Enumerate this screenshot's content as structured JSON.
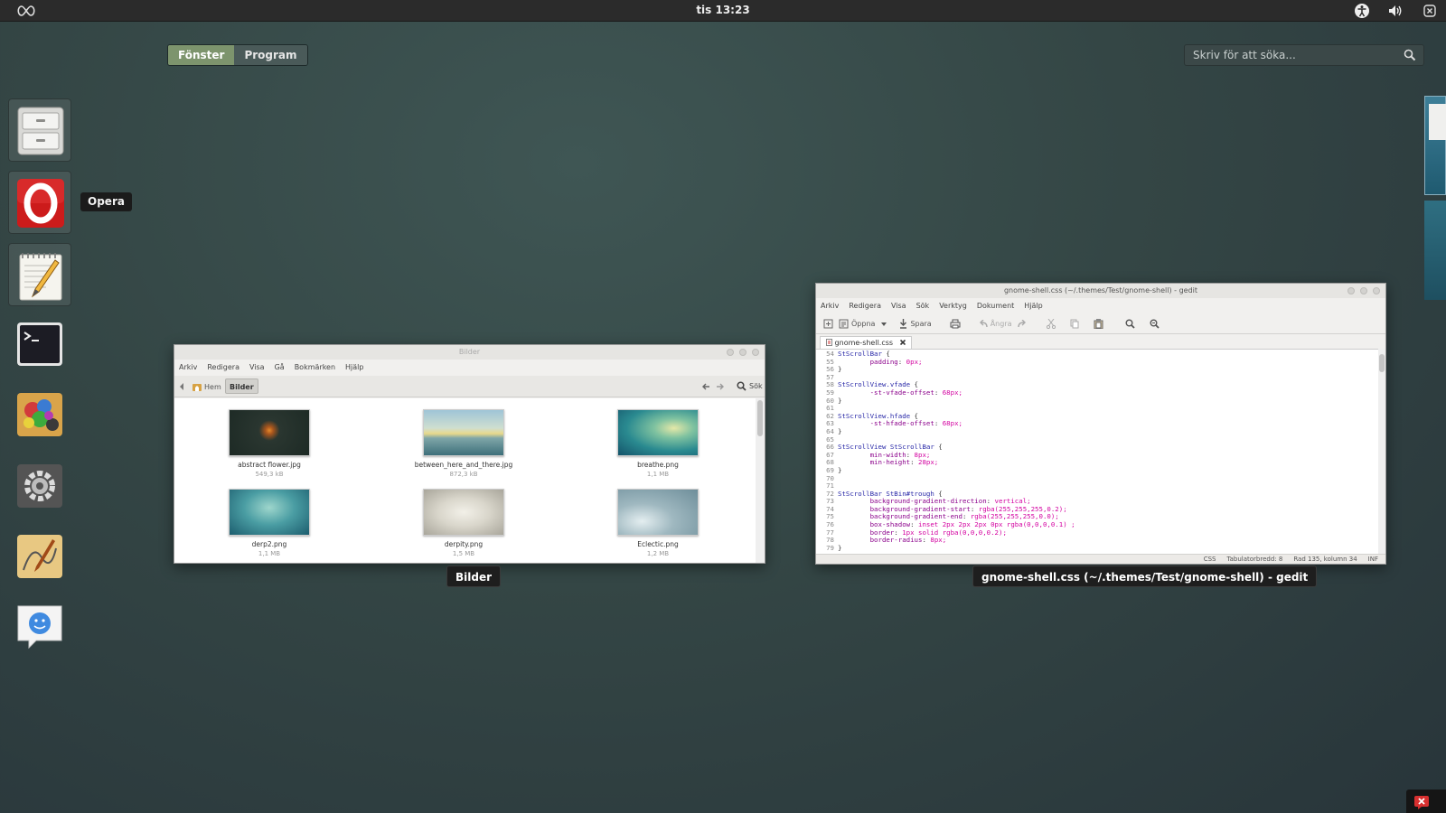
{
  "topbar": {
    "clock": "tis 13:23",
    "icons": [
      "activities-icon",
      "accessibility-icon",
      "volume-icon",
      "power-icon"
    ]
  },
  "view_switcher": {
    "windows_label": "Fönster",
    "applications_label": "Program"
  },
  "search": {
    "placeholder": "Skriv för att söka...",
    "icon": "search-icon"
  },
  "dock": {
    "items": [
      {
        "name": "Filer",
        "icon": "file-cabinet-icon",
        "running": true
      },
      {
        "name": "Opera",
        "icon": "opera-icon",
        "running": true
      },
      {
        "name": "gedit",
        "icon": "text-editor-icon",
        "running": true
      },
      {
        "name": "Terminal",
        "icon": "terminal-icon",
        "running": false
      },
      {
        "name": "GIMP",
        "icon": "paint-icon",
        "running": false
      },
      {
        "name": "Inställningar",
        "icon": "settings-gear-icon",
        "running": false
      },
      {
        "name": "Inkscape",
        "icon": "drawing-icon",
        "running": false
      },
      {
        "name": "Empathy",
        "icon": "chat-icon",
        "running": false
      }
    ],
    "tooltip": "Opera"
  },
  "file_manager": {
    "title": "Bilder",
    "caption": "Bilder",
    "menu": [
      "Arkiv",
      "Redigera",
      "Visa",
      "Gå",
      "Bokmärken",
      "Hjälp"
    ],
    "path": [
      "Hem",
      "Bilder"
    ],
    "search_label": "Sök",
    "files": [
      {
        "name": "abstract flower.jpg",
        "size": "549,3 kB"
      },
      {
        "name": "between_here_and_there.jpg",
        "size": "872,3 kB"
      },
      {
        "name": "breathe.png",
        "size": "1,1 MB"
      },
      {
        "name": "derp2.png",
        "size": "1,1 MB"
      },
      {
        "name": "derpity.png",
        "size": "1,5 MB"
      },
      {
        "name": "Eclectic.png",
        "size": "1,2 MB"
      }
    ]
  },
  "gedit": {
    "title": "gnome-shell.css (~/.themes/Test/gnome-shell) - gedit",
    "caption": "gnome-shell.css (~/.themes/Test/gnome-shell) - gedit",
    "menu": [
      "Arkiv",
      "Redigera",
      "Visa",
      "Sök",
      "Verktyg",
      "Dokument",
      "Hjälp"
    ],
    "toolbar": {
      "open": "Öppna",
      "save": "Spara",
      "undo": "Ångra"
    },
    "tab": "gnome-shell.css",
    "code": [
      {
        "n": "54",
        "t": "StScrollBar {"
      },
      {
        "n": "55",
        "t": "        padding: 0px;"
      },
      {
        "n": "56",
        "t": "}"
      },
      {
        "n": "57",
        "t": ""
      },
      {
        "n": "58",
        "t": "StScrollView.vfade {"
      },
      {
        "n": "59",
        "t": "        -st-vfade-offset: 68px;"
      },
      {
        "n": "60",
        "t": "}"
      },
      {
        "n": "61",
        "t": ""
      },
      {
        "n": "62",
        "t": "StScrollView.hfade {"
      },
      {
        "n": "63",
        "t": "        -st-hfade-offset: 68px;"
      },
      {
        "n": "64",
        "t": "}"
      },
      {
        "n": "65",
        "t": ""
      },
      {
        "n": "66",
        "t": "StScrollView StScrollBar {"
      },
      {
        "n": "67",
        "t": "        min-width: 8px;"
      },
      {
        "n": "68",
        "t": "        min-height: 28px;"
      },
      {
        "n": "69",
        "t": "}"
      },
      {
        "n": "70",
        "t": ""
      },
      {
        "n": "71",
        "t": ""
      },
      {
        "n": "72",
        "t": "StScrollBar StBin#trough {"
      },
      {
        "n": "73",
        "t": "        background-gradient-direction: vertical;"
      },
      {
        "n": "74",
        "t": "        background-gradient-start: rgba(255,255,255,0.2);"
      },
      {
        "n": "75",
        "t": "        background-gradient-end: rgba(255,255,255,0.0);"
      },
      {
        "n": "76",
        "t": "        box-shadow: inset 2px 2px 2px 0px rgba(0,0,0,0.1) ;"
      },
      {
        "n": "77",
        "t": "        border: 1px solid rgba(0,0,0,0.2);"
      },
      {
        "n": "78",
        "t": "        border-radius: 8px;"
      },
      {
        "n": "79",
        "t": "}"
      }
    ],
    "status": {
      "language": "CSS",
      "tab_width": "Tabulatorbredd: 8",
      "position": "Rad 135, kolumn 34",
      "mode": "INF"
    }
  },
  "colors": {
    "accent": "#7d946d",
    "panel": "#2b2b2b"
  }
}
